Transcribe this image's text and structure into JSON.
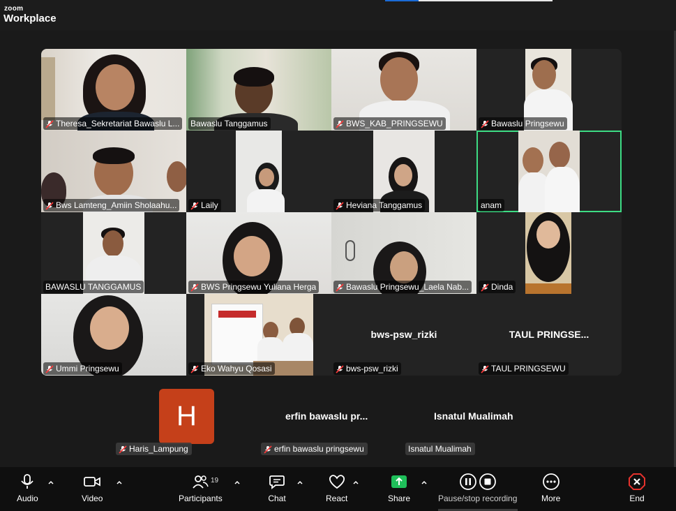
{
  "app": {
    "brand_small": "zoom",
    "brand_large": "Workplace"
  },
  "tiles": [
    {
      "label": "Theresa_Sekretariat Bawaslu L...",
      "muted": true
    },
    {
      "label": "Bawaslu Tanggamus",
      "muted": false
    },
    {
      "label": "BWS_KAB_PRINGSEWU",
      "muted": true
    },
    {
      "label": "Bawaslu Pringsewu",
      "muted": true
    },
    {
      "label": "Bws Lamteng_Amiin Sholaahu...",
      "muted": true
    },
    {
      "label": "Laily",
      "muted": true
    },
    {
      "label": "Heviana Tanggamus",
      "muted": true
    },
    {
      "label": "anam",
      "muted": false
    },
    {
      "label": "BAWASLU TANGGAMUS",
      "muted": false
    },
    {
      "label": "BWS Pringsewu Yuliana Herga",
      "muted": true
    },
    {
      "label": "Bawaslu Pringsewu_Laela Nab...",
      "muted": true
    },
    {
      "label": "Dinda",
      "muted": true
    },
    {
      "label": "Ummi Pringsewu",
      "muted": true
    },
    {
      "label": "Eko Wahyu Qosasi",
      "muted": true
    },
    {
      "label": "bws-psw_rizki",
      "muted": true,
      "center": "bws-psw_rizki"
    },
    {
      "label": "TAUL PRINGSEWU",
      "muted": true,
      "center": "TAUL PRINGSE..."
    }
  ],
  "bottom_row": [
    {
      "initial": "H",
      "label": "Haris_Lampung",
      "muted": true
    },
    {
      "center": "erfin bawaslu pr...",
      "label": "erfin bawaslu pringsewu",
      "muted": true
    },
    {
      "center": "Isnatul Mualimah",
      "label": "Isnatul Mualimah",
      "muted": false
    }
  ],
  "toolbar": {
    "audio": "Audio",
    "video": "Video",
    "participants": "Participants",
    "participants_count": "19",
    "chat": "Chat",
    "react": "React",
    "share": "Share",
    "recording": "Pause/stop recording",
    "more": "More",
    "end": "End"
  },
  "colors": {
    "active_speaker": "#3ddc84",
    "share": "#1fbf5a",
    "end": "#e5322d",
    "avatar": "#c5401a"
  }
}
